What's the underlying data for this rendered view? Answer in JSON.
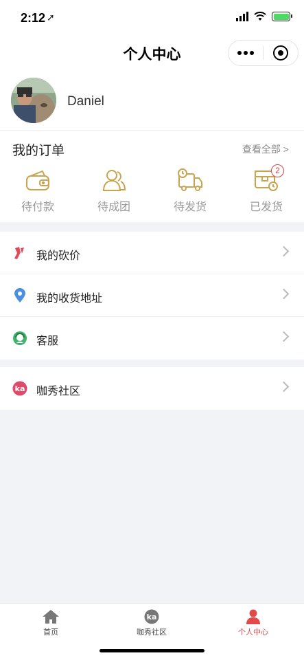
{
  "status": {
    "time": "2:12"
  },
  "nav": {
    "title": "个人中心"
  },
  "profile": {
    "name": "Daniel"
  },
  "orders": {
    "title": "我的订单",
    "view_all": "查看全部 >",
    "items": [
      {
        "label": "待付款",
        "icon": "wallet-icon"
      },
      {
        "label": "待成团",
        "icon": "users-icon"
      },
      {
        "label": "待发货",
        "icon": "truck-icon"
      },
      {
        "label": "已发货",
        "icon": "box-clock-icon",
        "badge": "2"
      }
    ]
  },
  "menu": {
    "bargain": "我的砍价",
    "address": "我的收货地址",
    "service": "客服",
    "community": "咖秀社区"
  },
  "tabs": [
    {
      "label": "首页",
      "icon": "home-icon"
    },
    {
      "label": "咖秀社区",
      "icon": "ka-icon"
    },
    {
      "label": "个人中心",
      "icon": "person-icon"
    }
  ],
  "colors": {
    "accent": "#e24a4a",
    "icon_gold": "#c9a34e",
    "page_bg": "#f2f3f7"
  }
}
